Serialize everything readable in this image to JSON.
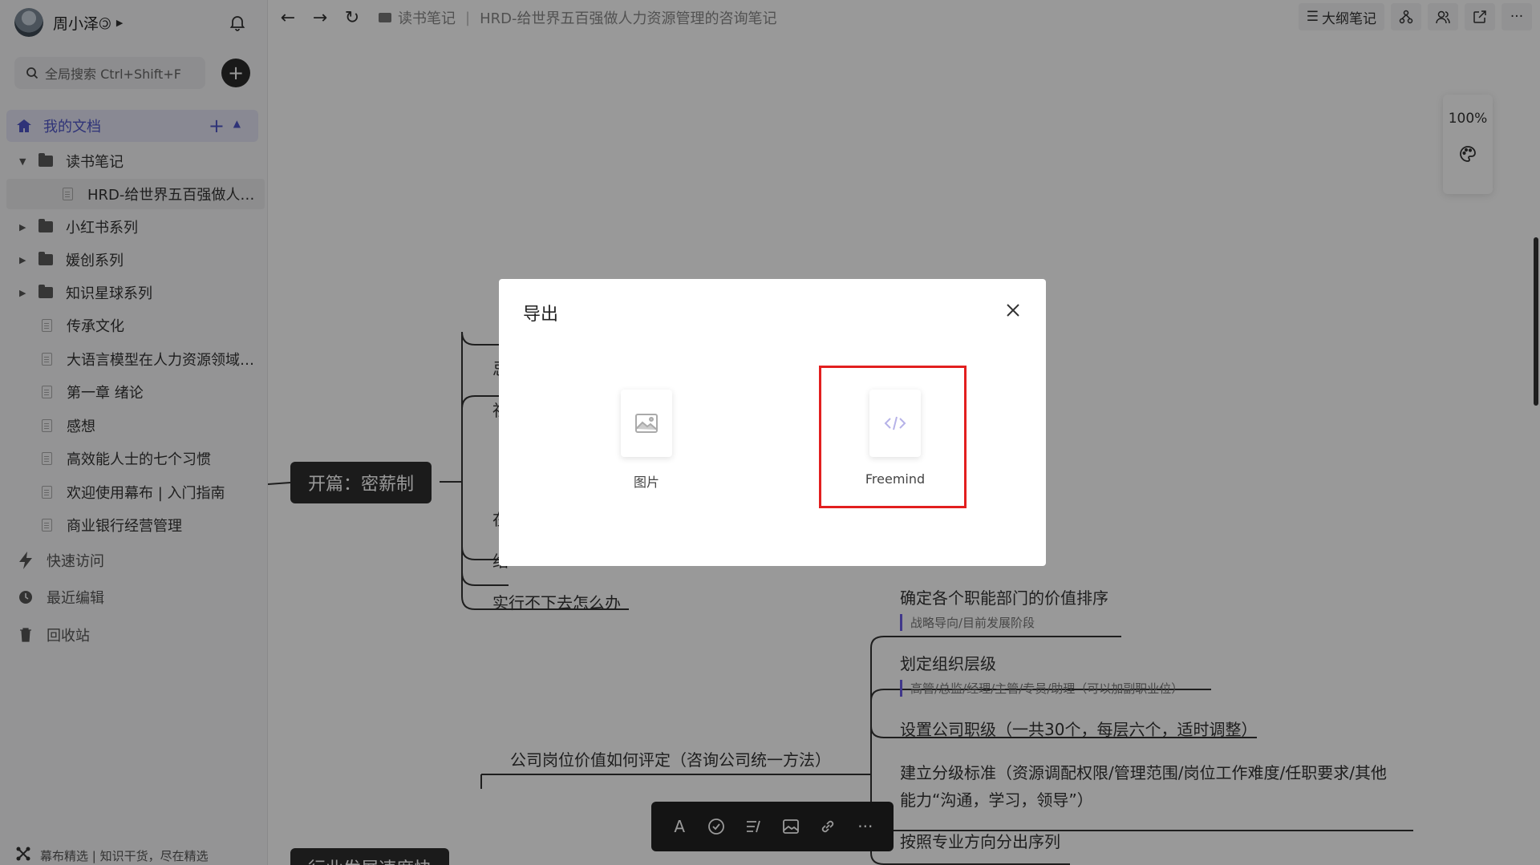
{
  "sidebar": {
    "user_name": "周小泽🄯",
    "search_placeholder": "全局搜索 Ctrl+Shift+F",
    "my_docs_label": "我的文档",
    "tree": [
      {
        "label": "读书笔记",
        "type": "folder",
        "expanded": true
      },
      {
        "label": "HRD-给世界五百强做人…",
        "type": "doc",
        "selected": true
      },
      {
        "label": "小红书系列",
        "type": "folder"
      },
      {
        "label": "媛创系列",
        "type": "folder"
      },
      {
        "label": "知识星球系列",
        "type": "folder"
      },
      {
        "label": "传承文化",
        "type": "doc"
      },
      {
        "label": "大语言模型在人力资源领域…",
        "type": "doc"
      },
      {
        "label": "第一章 绪论",
        "type": "doc"
      },
      {
        "label": "感想",
        "type": "doc"
      },
      {
        "label": "高效能人士的七个习惯",
        "type": "doc"
      },
      {
        "label": "欢迎使用幕布 | 入门指南",
        "type": "doc"
      },
      {
        "label": "商业银行经营管理",
        "type": "doc"
      }
    ],
    "quick_access": "快速访问",
    "recent_edit": "最近编辑",
    "recycle_bin": "回收站",
    "footer": "幕布精选 | 知识干货，尽在精选"
  },
  "topbar": {
    "breadcrumb_folder": "读书笔记",
    "breadcrumb_doc": "HRD-给世界五百强做人力资源管理的咨询笔记",
    "outline_label": "大纲笔记",
    "more_label": "···"
  },
  "canvas": {
    "zoom": "100%",
    "root_node": "开篇：密薪制",
    "partial_nodes": [
      "忌",
      "社",
      "在",
      "绍",
      "实行不下去怎么办"
    ],
    "branch_node": "公司岗位价值如何评定（咨询公司统一方法）",
    "children": [
      {
        "text": "确定各个职能部门的价值排序",
        "note": "战略导向/目前发展阶段"
      },
      {
        "text": "划定组织层级",
        "note": "高管/总监/经理/主管/专员/助理（可以加副职业位）"
      },
      {
        "text": "设置公司职级（一共30个，每层六个，适时调整）",
        "note": ""
      },
      {
        "text": "建立分级标准（资源调配权限/管理范围/岗位工作难度/任职要求/其他能力“沟通，学习，领导”）",
        "text_line1": "建立分级标准（资源调配权限/管理范围/岗位工作难度/任职要求/其他",
        "text_line2": "能力“沟通，学习，领导”）",
        "note": ""
      },
      {
        "text": "按照专业方向分出序列",
        "note": ""
      }
    ],
    "bottom_node": "行业发展速度快"
  },
  "modal": {
    "title": "导出",
    "options": [
      {
        "label": "图片",
        "icon": "image-icon"
      },
      {
        "label": "Freemind",
        "icon": "code-icon",
        "highlighted": true
      }
    ]
  },
  "colors": {
    "accent": "#4f56c8",
    "highlight": "#e21f1f",
    "note_bar": "#6b5de8"
  }
}
